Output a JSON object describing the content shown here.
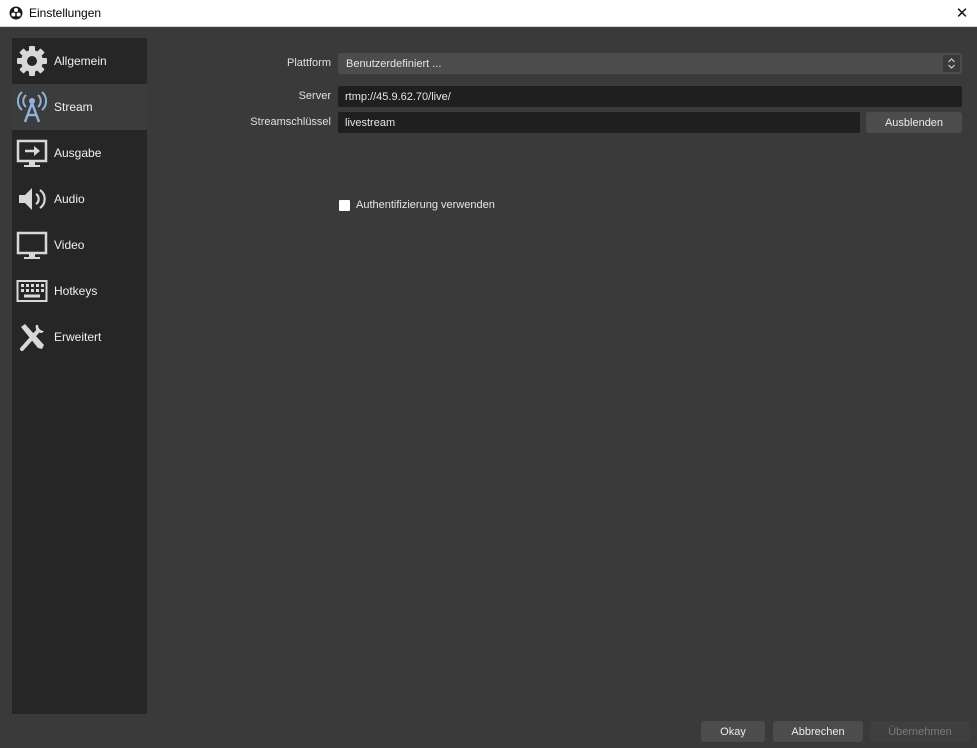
{
  "window": {
    "title": "Einstellungen",
    "close_glyph": "✕"
  },
  "sidebar": {
    "items": [
      {
        "label": "Allgemein",
        "icon": "gear-icon"
      },
      {
        "label": "Stream",
        "icon": "antenna-icon",
        "active": true
      },
      {
        "label": "Ausgabe",
        "icon": "output-icon"
      },
      {
        "label": "Audio",
        "icon": "speaker-icon"
      },
      {
        "label": "Video",
        "icon": "monitor-icon"
      },
      {
        "label": "Hotkeys",
        "icon": "keyboard-icon"
      },
      {
        "label": "Erweitert",
        "icon": "tools-icon"
      }
    ]
  },
  "stream": {
    "platform_label": "Plattform",
    "platform_value": "Benutzerdefiniert ...",
    "server_label": "Server",
    "server_value": "rtmp://45.9.62.70/live/",
    "key_label": "Streamschlüssel",
    "key_value": "livestream",
    "hide_button": "Ausblenden",
    "auth_label": "Authentifizierung verwenden",
    "auth_checked": false
  },
  "footer": {
    "ok": "Okay",
    "cancel": "Abbrechen",
    "apply": "Übernehmen"
  },
  "colors": {
    "background": "#3a3a3a",
    "sidebar": "#262626",
    "sidebar_active": "#3c3c3c",
    "input_bg": "#1f1f1f",
    "button_bg": "#4c4c4c",
    "icon_light": "#d8d8d8",
    "stream_icon": "#8fb3d9"
  }
}
